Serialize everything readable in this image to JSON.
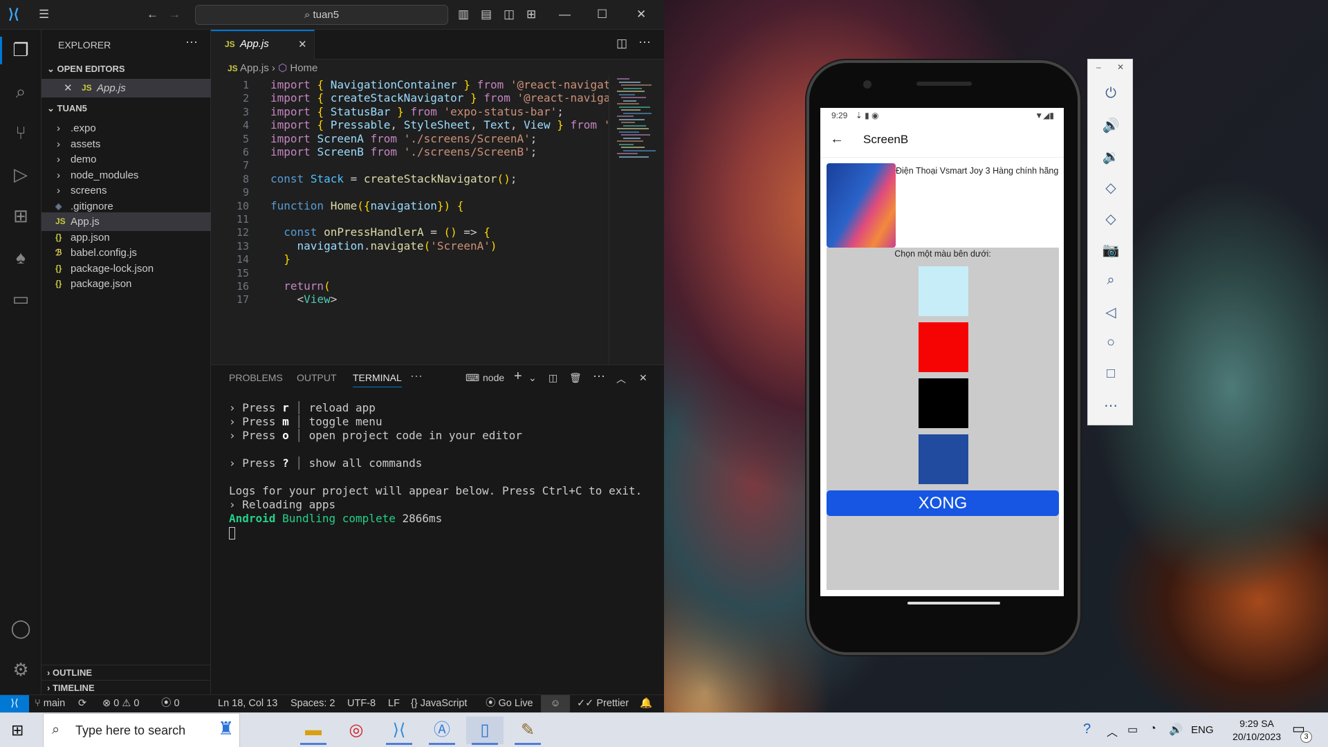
{
  "vscode": {
    "title_search": "tuan5",
    "explorer": {
      "header": "EXPLORER",
      "open_editors_label": "OPEN EDITORS",
      "open_editor_file": "App.js",
      "project_label": "TUAN5",
      "items": [
        {
          "name": ".expo",
          "type": "folder"
        },
        {
          "name": "assets",
          "type": "folder"
        },
        {
          "name": "demo",
          "type": "folder"
        },
        {
          "name": "node_modules",
          "type": "folder"
        },
        {
          "name": "screens",
          "type": "folder"
        },
        {
          "name": ".gitignore",
          "type": "git"
        },
        {
          "name": "App.js",
          "type": "js"
        },
        {
          "name": "app.json",
          "type": "json"
        },
        {
          "name": "babel.config.js",
          "type": "babel"
        },
        {
          "name": "package-lock.json",
          "type": "json"
        },
        {
          "name": "package.json",
          "type": "json"
        }
      ],
      "outline_label": "OUTLINE",
      "timeline_label": "TIMELINE"
    },
    "tab": {
      "file": "App.js",
      "badge": "JS"
    },
    "breadcrumb": {
      "file": "App.js",
      "symbol": "Home"
    },
    "code_lines": [
      "import { NavigationContainer } from '@react-navigat",
      "import { createStackNavigator } from '@react-naviga",
      "import { StatusBar } from 'expo-status-bar';",
      "import { Pressable, StyleSheet, Text, View } from '",
      "import ScreenA from './screens/ScreenA';",
      "import ScreenB from './screens/ScreenB';",
      "",
      "const Stack = createStackNavigator();",
      "",
      "function Home({navigation}) {",
      "",
      "  const onPressHandlerA = () => {",
      "    navigation.navigate('ScreenA')",
      "  }",
      "",
      "  return(",
      "    <View>"
    ],
    "line_numbers": [
      "1",
      "2",
      "3",
      "4",
      "5",
      "6",
      "7",
      "8",
      "9",
      "10",
      "11",
      "12",
      "13",
      "14",
      "15",
      "16",
      "17"
    ],
    "panel": {
      "tabs": [
        "PROBLEMS",
        "OUTPUT",
        "TERMINAL"
      ],
      "active_tab": "TERMINAL",
      "shell": "node"
    },
    "terminal": {
      "lines": [
        {
          "prefix": "› Press ",
          "key": "r",
          "desc": "reload app"
        },
        {
          "prefix": "› Press ",
          "key": "m",
          "desc": "toggle menu"
        },
        {
          "prefix": "› Press ",
          "key": "o",
          "desc": "open project code in your editor"
        },
        {
          "prefix": "› Press ",
          "key": "?",
          "desc": "show all commands"
        }
      ],
      "logs_line": "Logs for your project will appear below. Press Ctrl+C to exit.",
      "reloading_line": "› Reloading apps",
      "bundle_platform": "Android",
      "bundle_text": "Bundling complete",
      "bundle_time": "2866ms"
    },
    "status_bar": {
      "branch": "main",
      "errors": "0",
      "warnings": "0",
      "ports": "0",
      "position": "Ln 18, Col 13",
      "spaces": "Spaces: 2",
      "encoding": "UTF-8",
      "eol": "LF",
      "language": "JavaScript",
      "go_live": "Go Live",
      "prettier": "Prettier"
    }
  },
  "phone": {
    "time": "9:29",
    "screen_title": "ScreenB",
    "product_title": "Điện Thoại Vsmart Joy 3 Hàng chính hãng",
    "palette_label": "Chọn một màu bên dưới:",
    "swatch_colors": [
      "#c7eef8",
      "#f60303",
      "#000000",
      "#214b9f"
    ],
    "button_label": "XONG"
  },
  "taskbar": {
    "search_placeholder": "Type here to search",
    "language": "ENG",
    "time": "9:29 SA",
    "date": "20/10/2023",
    "notification_count": "3"
  },
  "colors": {
    "accent": "#0078d4",
    "button_blue": "#1656e3"
  }
}
